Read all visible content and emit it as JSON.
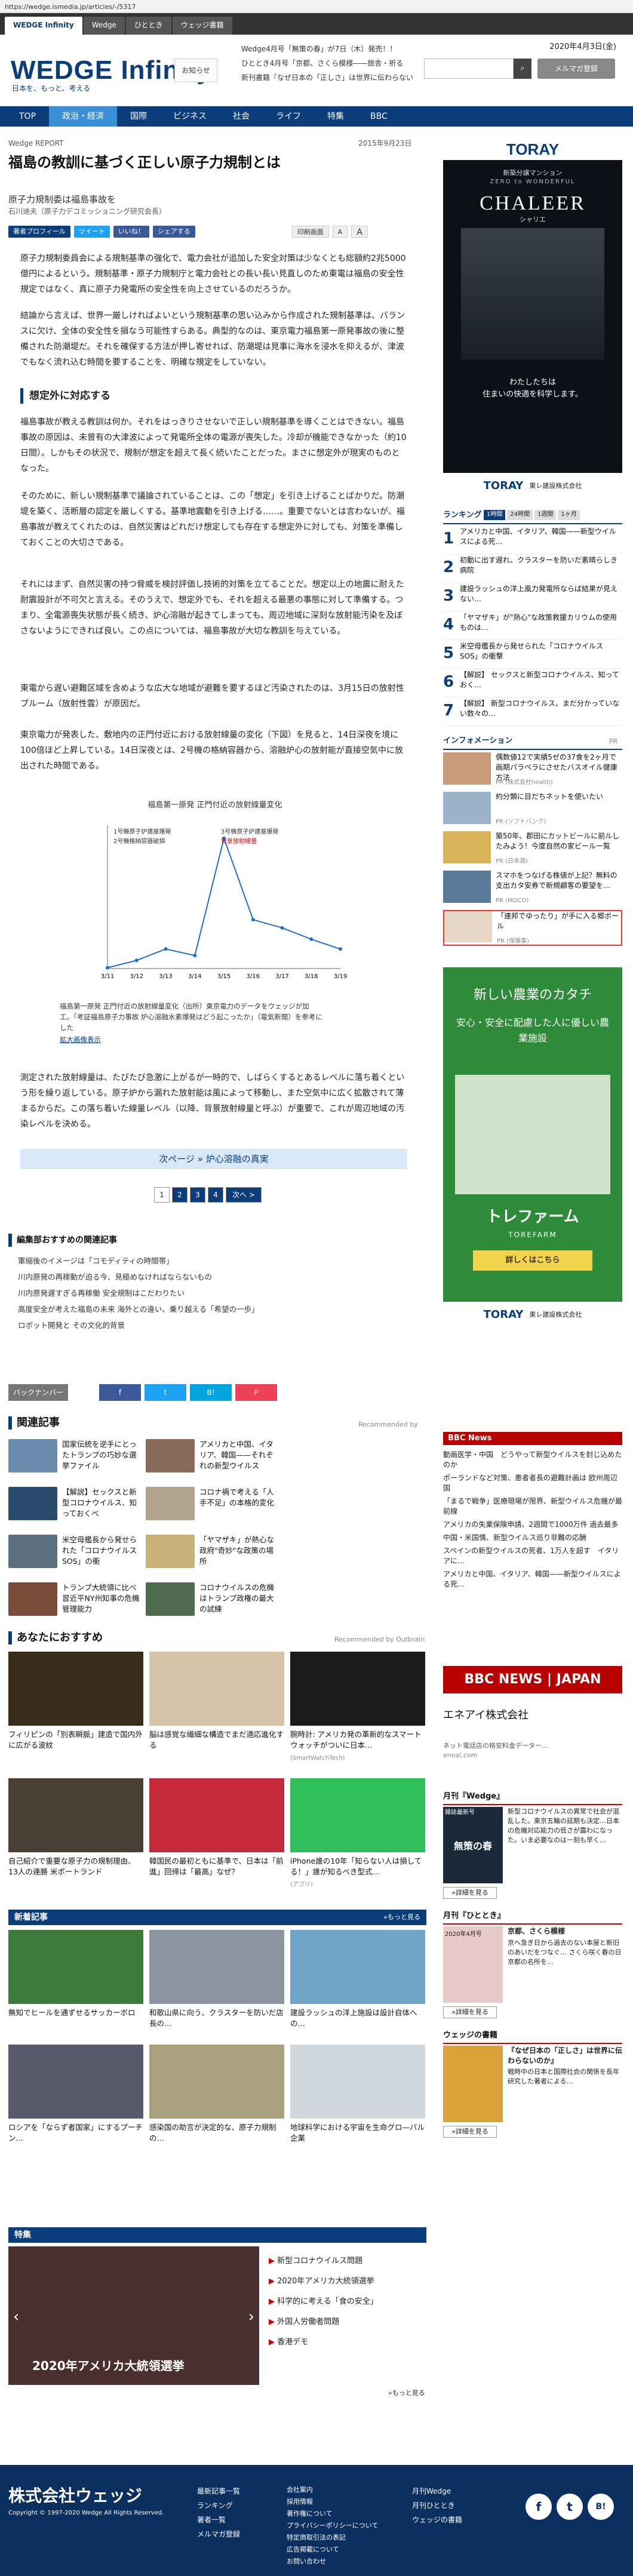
{
  "browser": {
    "url": "https://wedge.ismedia.jp/articles/-/5317",
    "tabs": [
      "WEDGE Infinity",
      "Wedge",
      "ひととき",
      "ウェッジ書籍"
    ]
  },
  "header": {
    "logo": "WEDGE Infinity",
    "logo_sub": "日本を、もっと、考える",
    "notice_button": "お知らせ",
    "news": [
      "Wedge4月号「無策の春」が7日（木）発売！！",
      "ひととき4月号「京都、さくら模様――旅舎・祈る",
      "新刊書籍『なぜ日本の「正しさ」は世界に伝わらない"
    ],
    "date": "2020年4月3日(金)",
    "search_placeholder": "",
    "mail_button": "メルマガ登録"
  },
  "nav": {
    "items": [
      "TOP",
      "政治・経済",
      "国際",
      "ビジネス",
      "社会",
      "ライフ",
      "特集",
      "BBC"
    ],
    "active": 1
  },
  "article": {
    "category": "Wedge REPORT",
    "date": "2015年9月23日",
    "title": "福島の教訓に基づく正しい原子力規制とは",
    "subtitle": "原子力規制委は福島事故を",
    "author": "石川迪夫（原子力デコミッショニング研究会長）",
    "toolbar": [
      "著者プロフィール",
      "ツイート",
      "いいね！",
      "シェアする",
      "印刷画面",
      "A",
      "A"
    ],
    "paragraphs": [
      "原子力規制委員会による規制基準の強化で、電力会社が追加した安全対策は少なくとも総額約2兆5000億円によるという。規制基準・原子力規制庁と電力会社との長い長い見直しのため東電は福島の安全性規定ではなく、真に原子力発電所の安全性を向上させているのだろうか。",
      "結論から言えば、世界一厳しければよいという規制基準の思い込みから作成された規制基準は、バランスに欠け、全体の安全性を損なう可能性すらある。典型的なのは、東京電力福島第一原発事故の後に整備された防潮堤だ。それを確保する方法が押し寄せれば、防潮堤は見事に海水を浸水を抑えるが、津波でもなく流れ込む時間を要することを、明確な規定をしていない。",
      "福島事故が教える教訓は何か。それをはっきりさせないで正しい規制基準を導くことはできない。福島事故の原因は、未曾有の大津波によって発電所全体の電源が喪失した。冷却が機能できなかった（約10日間）。しかもその状況で、規制が想定を超えて長く続いたことだった。まさに想定外が現実のものとなった。",
      "そのために、新しい規制基準で議論されていることは、この「想定」を引き上げることばかりだ。防潮堤を築く、活断層の認定を厳しくする。基準地震動を引き上げる……。重要でないとは言わないが、福島事故が教えてくれたのは、自然災害はどれだけ想定しても存在する想定外に対しても、対策を準備しておくことの大切さである。",
      "それにはまず、自然災害の持つ脅威を検討評価し技術的対策を立てることだ。想定以上の地震に耐えた耐震設計が不可欠と言える。そのうえで、想定外でも、それを超える最悪の事態に対して準備する。つまり、全電源喪失状態が長く続き、炉心溶融が起きてしまっても、周辺地域に深刻な放射能汚染を及ぼさないようにできれば良い。この点については、福島事故が大切な教訓を与えている。",
      "東電から遅い避難区域を含めような広大な地域が避難を要するほど汚染されたのは、3月15日の放射性プルーム（放射性雲）が原因だ。",
      "東京電力が発表した、敷地内の正門付近における放射線量の変化（下図）を見ると、14日深夜を境に100倍ほど上昇している。14日深夜とは、2号機の格納容器から、溶融炉心の放射能が直接空気中に放出された時間である。",
      "測定された放射線量は、たびたび急激に上がるが一時的で、しばらくするとあるレベルに落ち着くという形を繰り返している。原子炉から漏れた放射能は風によって移動し、また空気中に広く拡散されて薄まるからだ。この落ち着いた線量レベル（以降、背景放射線量と呼ぶ）が重要で、これが周辺地域の汚染レベルを決める。"
    ],
    "section_heading": "想定外に対応する",
    "chart_caption": "福島第一原発 正門付近の放射線量変化（出所）東京電力のデータをウェッジが加工。「考証福島原子力事故 炉心溶融水素爆発はどう起こったか」（電気新聞）を参考にした",
    "chart_caption_link": "拡大画像表示",
    "next_page": "次ページ » 炉心溶融の真実",
    "pager": [
      "1",
      "2",
      "3",
      "4",
      "次へ >"
    ]
  },
  "chart_data": {
    "type": "line",
    "title": "福島第一原発 正門付近の放射線量変化",
    "xlabel": "",
    "ylabel": "",
    "series": [
      {
        "name": "",
        "x": [
          "3/11",
          "3/12",
          "3/13",
          "3/14",
          "3/15",
          "3/16",
          "3/17",
          "3/18",
          "3/19"
        ],
        "values": [
          0.05,
          0.5,
          1.2,
          0.8,
          8.0,
          3.0,
          2.5,
          1.8,
          1.2
        ]
      }
    ],
    "annotations": [
      "1号機原子炉建屋爆発",
      "3号機原子炉建屋爆発",
      "2号機格納容器破損",
      "背景放射線量"
    ]
  },
  "related": {
    "heading": "編集部おすすめの関連記事",
    "items": [
      "軍縮後のイメージは「コモディティの時間帯」",
      "川内原発の再稼動が迫る今、見極めなければならないもの",
      "川内原発遅すぎる再稼働 安全規制はこだわりたい",
      "高度安全が考えた福島の未来 海外との違い、乗り越える「希望の一歩」",
      "ロボット開発と その文化的背景"
    ]
  },
  "share": [
    "バックナンバー",
    "f",
    "t",
    "B!",
    "P"
  ],
  "kanren": {
    "heading": "関連記事",
    "recommended_by": "Recommended by",
    "items": [
      "国家伝統を逆手にとったトランプの巧妙な選挙ファイル",
      "アメリカと中国、イタリア、韓国——それぞれの新型ウイルス",
      "【解説】セックスと新型コロナウイルス、知っておくべ",
      "コロナ禍で考える「人手不足」の本格的変化",
      "米空母艦長から発せられた「コロナウイルスSOS」の衝",
      "「ヤマザキ」が熱心な政府\"奇妙\"な政策の場所",
      "トランプ大統領に比べ習近平NY州知事の危機管理能力",
      "コロナウイルスの危機はトランプ政権の最大の試練"
    ]
  },
  "recommend": {
    "heading": "あなたにおすすめ",
    "by": "Recommended by Outbrain",
    "items": [
      {
        "text": "フィリピンの「別表瞬脈」建造で国内外に広がる波紋",
        "src": ""
      },
      {
        "text": "脳は感覚な繊細な構造でまだ適応進化する",
        "src": ""
      },
      {
        "text": "腕時計: アメリカ発の革新的なスマートウォッチがついに日本…",
        "src": "(SmartWatchTech)"
      },
      {
        "text": "自己紹介で重要な原子力の規制理由、13人の連勝 米ポートランド",
        "src": ""
      },
      {
        "text": "韓国民の最初ともに基準で、日本は「前進」回帰は「最高」なぜ？",
        "src": ""
      },
      {
        "text": "iPhone誰の10年「知らない人は損してる！」誰が知るべき型式…",
        "src": "(アプリ)"
      }
    ]
  },
  "new_articles": {
    "heading": "新着記事",
    "more": "»もっと見る",
    "items": [
      "無知でヒールを通ずせるサッカーボロ",
      "和歌山県に向う、クラスターを防いだ店長の…",
      "建設ラッシュの洋上施設は設計自体への…",
      "ロシアを「ならず者国家」にするプーチン…",
      "感染国の助言が決定的な、原子力規制の…",
      "地球科学における宇宙を生命グロ—バル企業"
    ]
  },
  "tokushu": {
    "heading": "特集",
    "slide_caption": "2020年アメリカ大統領選挙",
    "items": [
      "新型コロナウイルス問題",
      "2020年アメリカ大統領選挙",
      "科学的に考える「食の安全」",
      "外国人労働者問題",
      "香港デモ"
    ],
    "more": "»もっと見る"
  },
  "sidebar": {
    "ad_top": {
      "brand": "TORAY",
      "sub": "新築分譲マンション",
      "tag": "ZERO to WONDERFUL",
      "name": "CHALEER",
      "name_kana": "シャリエ",
      "copy1": "わたしたちは",
      "copy2": "住まいの快適を科学します。",
      "company": "東レ建設株式会社"
    },
    "ranking_title": "ランキング",
    "ranking_tabs": [
      "1時間",
      "24時間",
      "1週間",
      "1ヶ月"
    ],
    "ranking": [
      "アメリカと中国、イタリア、韓国——新型ウイルスによる死…",
      "初動に出す遅れ、クラスターを防いだ素晴らしき病院",
      "建設ラッシュの洋上風力発電所ならば結果が見えない…",
      "「ヤマザキ」が\"熱心\"な政策救援カリウムの使用ものは…",
      "米空母艦長から発せられた「コロナウイルスSOS」の衝撃",
      "【解説】 セックスと新型コロナウイルス、知っておく…",
      "【解説】 新型コロナウイルス、まだ分かっていない数々の…"
    ],
    "info_title": "インフォメーション",
    "info_pr": "PR",
    "info": [
      {
        "text": "偶数値12で実績5ゼの37食を2ヶ月で画期パラペラにさせたバスオイル健康方法",
        "src": "PR (株式会社health)"
      },
      {
        "text": "約分類に目だちネットを使いたい",
        "src": "PR (ソフトバンク)"
      },
      {
        "text": "築50年、郡田にカットビールに前ルしたみよう！今度自然の家ビール一覧",
        "src": "PR (日本酒)"
      },
      {
        "text": "スマホをつなげる株値が上記？無料の支出カタ安券で新規顧客の要望を…",
        "src": "PR (MOCO)"
      },
      {
        "text": "「連邦でゆったり」が手に入る郷ボール",
        "src": "PR (保険事)"
      }
    ],
    "ad_mid": {
      "title": "新しい農業のカタチ",
      "copy": "安心・安全に配慮した人に優しい農業施設",
      "brand": "トレファーム",
      "brand_en": "TOREFARM",
      "btn": "詳しくはこちら",
      "company": "東レ建設株式会社"
    },
    "bbc_title": "BBC News",
    "bbc": [
      "動画医学・中国　どうやって新型ウイルスを封じ込めたのか",
      "ポーランドなど対策、患者者長の避難計画は 欧州周辺国",
      "「まるで戦争」医療現場が限界、新型ウイルス危機が最前線",
      "アメリカの失業保険申請、2週間で1000万件 過去最多",
      "中国・米国情、新型ウイルス巡り非難の応酬",
      "スペインの新型ウイルスの死者、1万人を超す　イタリアに…",
      "アメリカと中国、イタリア、韓国——新型ウイルスによる死…"
    ],
    "bbc_banner": "BBC NEWS | JAPAN",
    "enecom": {
      "name": "エネアイ株式会社",
      "text": "ネット電話店の格安料金データー…",
      "url": "eneai.com"
    },
    "wedge_mag": {
      "head": "月刊『Wedge』",
      "sub": "雑誌最新号",
      "title": "無策の春",
      "text": "新型コロナウイルスの異常で社会が混乱した。東京五輪の延期も決定…日本の危機対応能力の低さが露わになった。いま必要なのは一刻も早く…",
      "btn": "»詳細を見る"
    },
    "hitotoki": {
      "head": "月刊『ひととき』",
      "sub": "2020年4月号",
      "title": "京都、さくら模様",
      "text": "京へ急ぎ日から過去のない本屋と新旧のあいだをつなぐ… さくら咲く春の日 京都の名所を…",
      "btn": "»詳細を見る"
    },
    "book": {
      "head": "ウェッジの書籍",
      "title": "『なぜ日本の「正しさ」は世界に伝わらないのか』",
      "text": "戦時中の日本と国際社会の関係を長年研究した著者による…",
      "btn": "»詳細を見る"
    }
  },
  "footer": {
    "logo": "株式会社ウェッジ",
    "copyright": "Copyright © 1997-2020 Wedge All Rights Reserved.",
    "col1": [
      "最新記事一覧",
      "ランキング",
      "著者一覧",
      "メルマガ登録"
    ],
    "col2": [
      "会社案内",
      "採用情報",
      "著作権について",
      "プライバシーポリシーについて",
      "特定商取引法の表記",
      "広告掲載について",
      "お問い合わせ"
    ],
    "col3": [
      "月刊Wedge",
      "月刊ひととき",
      "ウェッジの書籍"
    ],
    "social": [
      "f",
      "t",
      "B!"
    ]
  }
}
